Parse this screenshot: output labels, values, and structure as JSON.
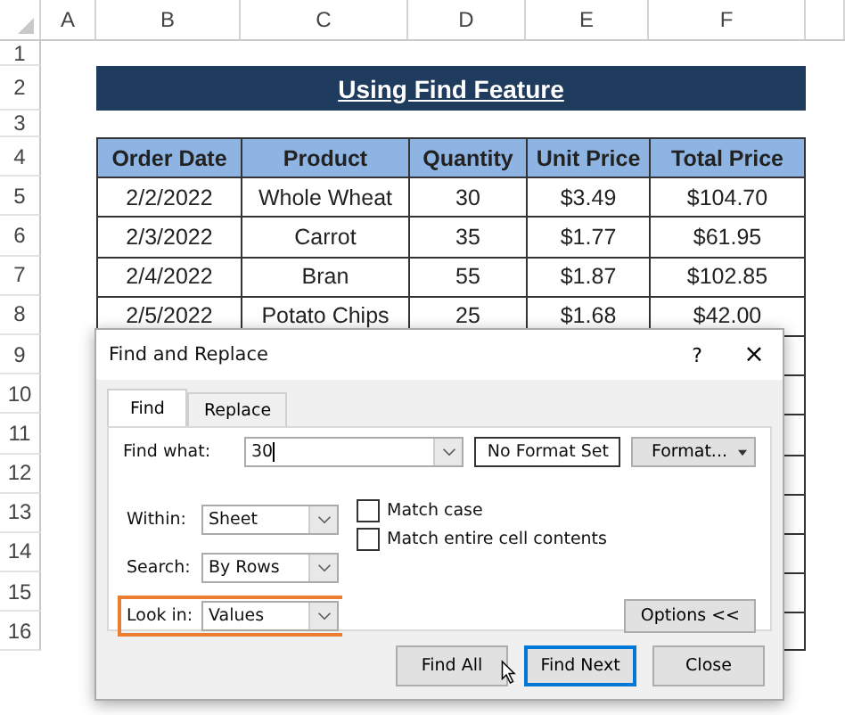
{
  "columns": [
    "A",
    "B",
    "C",
    "D",
    "E",
    "F"
  ],
  "row_numbers": [
    "1",
    "2",
    "3",
    "4",
    "5",
    "6",
    "7",
    "8",
    "9",
    "10",
    "11",
    "12",
    "13",
    "14",
    "15",
    "16"
  ],
  "title": "Using Find Feature",
  "table": {
    "columns": [
      "Order Date",
      "Product",
      "Quantity",
      "Unit Price",
      "Total Price"
    ],
    "rows": [
      [
        "2/2/2022",
        "Whole Wheat",
        "30",
        "$3.49",
        "$104.70"
      ],
      [
        "2/3/2022",
        "Carrot",
        "35",
        "$1.77",
        "$61.95"
      ],
      [
        "2/4/2022",
        "Bran",
        "55",
        "$1.87",
        "$102.85"
      ],
      [
        "2/5/2022",
        "Potato Chips",
        "25",
        "$1.68",
        "$42.00"
      ]
    ]
  },
  "dialog": {
    "title": "Find and Replace",
    "help": "?",
    "close": "×",
    "tabs": [
      {
        "label": "Find",
        "selected": true
      },
      {
        "label": "Replace",
        "selected": false
      }
    ],
    "find_what": {
      "label": "Find what:",
      "value": "30"
    },
    "format_status": "No Format Set",
    "format_button": "Format...",
    "dropdowns": [
      {
        "label": "Within:",
        "value": "Sheet",
        "highlighted": false
      },
      {
        "label": "Search:",
        "value": "By Rows",
        "highlighted": false
      },
      {
        "label": "Look in:",
        "value": "Values",
        "highlighted": true
      }
    ],
    "checkboxes": [
      {
        "label": "Match case",
        "checked": false
      },
      {
        "label": "Match entire cell contents",
        "checked": false
      }
    ],
    "options_button": "Options <<",
    "buttons": [
      {
        "label": "Find All",
        "default": false
      },
      {
        "label": "Find Next",
        "default": true
      },
      {
        "label": "Close",
        "default": false
      }
    ]
  }
}
